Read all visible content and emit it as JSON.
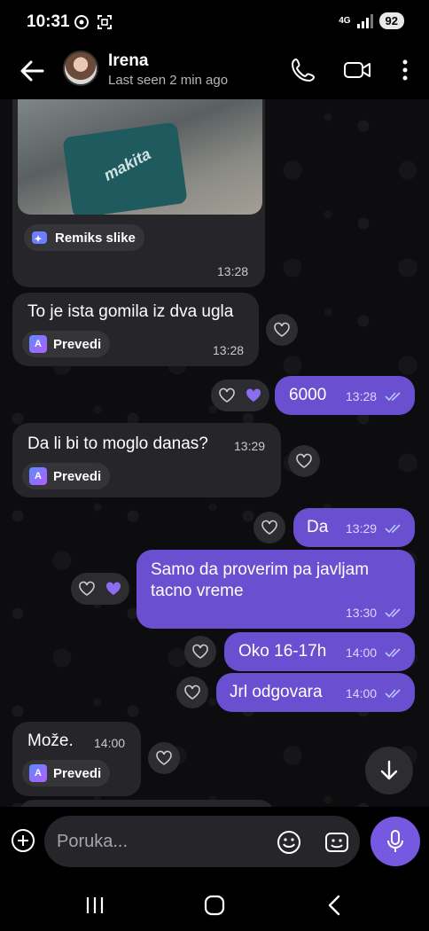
{
  "status_bar": {
    "time": "10:31",
    "network": "4G",
    "battery": "92"
  },
  "header": {
    "contact_name": "Irena",
    "last_seen": "Last seen 2 min ago"
  },
  "messages": [
    {
      "id": "m1",
      "direction": "in",
      "type": "image",
      "photo_text": "makita",
      "action": "Remiks slike",
      "time": "13:28"
    },
    {
      "id": "m2",
      "direction": "in",
      "text": "To je ista gomila iz dva ugla",
      "action": "Prevedi",
      "time": "13:28"
    },
    {
      "id": "m3",
      "direction": "out",
      "text": "6000",
      "time": "13:28",
      "reaction": "liked"
    },
    {
      "id": "m4",
      "direction": "in",
      "text": "Da li bi to moglo danas?",
      "action": "Prevedi",
      "time": "13:29"
    },
    {
      "id": "m5",
      "direction": "out",
      "text": "Da",
      "time": "13:29"
    },
    {
      "id": "m6",
      "direction": "out",
      "text_line1": "Samo da proverim pa javljam",
      "text_line2": "tacno vreme",
      "time": "13:30",
      "reaction": "liked"
    },
    {
      "id": "m7",
      "direction": "out",
      "text": "Oko 16-17h",
      "time": "14:00"
    },
    {
      "id": "m8",
      "direction": "out",
      "text": "Jrl odgovara",
      "time": "14:00"
    },
    {
      "id": "m9",
      "direction": "in",
      "text": "Može.",
      "action": "Prevedi",
      "time": "14:00"
    }
  ],
  "composer": {
    "placeholder": "Poruka..."
  },
  "colors": {
    "accent": "#6a4fd1",
    "incoming": "#25252a",
    "read_ticks": "#9fb6ff"
  }
}
